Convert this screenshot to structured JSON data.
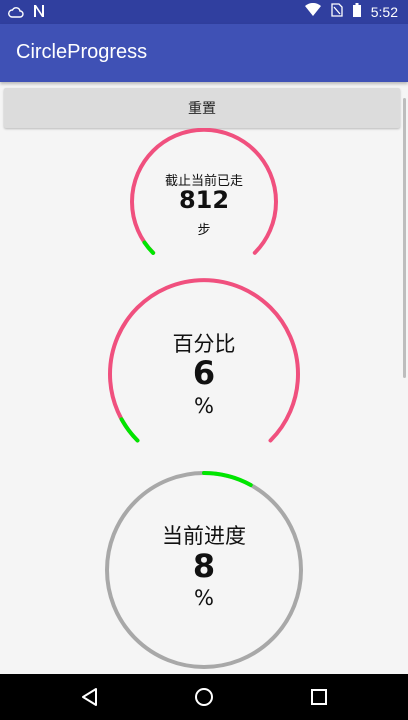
{
  "status_bar": {
    "time": "5:52",
    "icons": [
      "cloud-icon",
      "n-notification-icon",
      "wifi-icon",
      "no-sim-icon",
      "battery-icon"
    ]
  },
  "app_bar": {
    "title": "CircleProgress"
  },
  "reset_button": {
    "label": "重置"
  },
  "gauges": [
    {
      "title": "截止当前已走",
      "value": "812",
      "unit": "步",
      "progress_fraction": 0.04,
      "track_color": "#f0507e",
      "progress_color": "#00e600"
    },
    {
      "title": "百分比",
      "value": "6",
      "unit": "%",
      "progress_fraction": 0.06,
      "track_color": "#f0507e",
      "progress_color": "#00e600"
    },
    {
      "title": "当前进度",
      "value": "8",
      "unit": "%",
      "progress_fraction": 0.08,
      "track_color": "#a8a8a8",
      "progress_color": "#00e600"
    }
  ],
  "colors": {
    "primary": "#3f51b5",
    "primary_dark": "#303f9f",
    "background": "#f5f5f5"
  },
  "nav_bar": {
    "icons": [
      "back-icon",
      "home-icon",
      "recents-icon"
    ]
  }
}
